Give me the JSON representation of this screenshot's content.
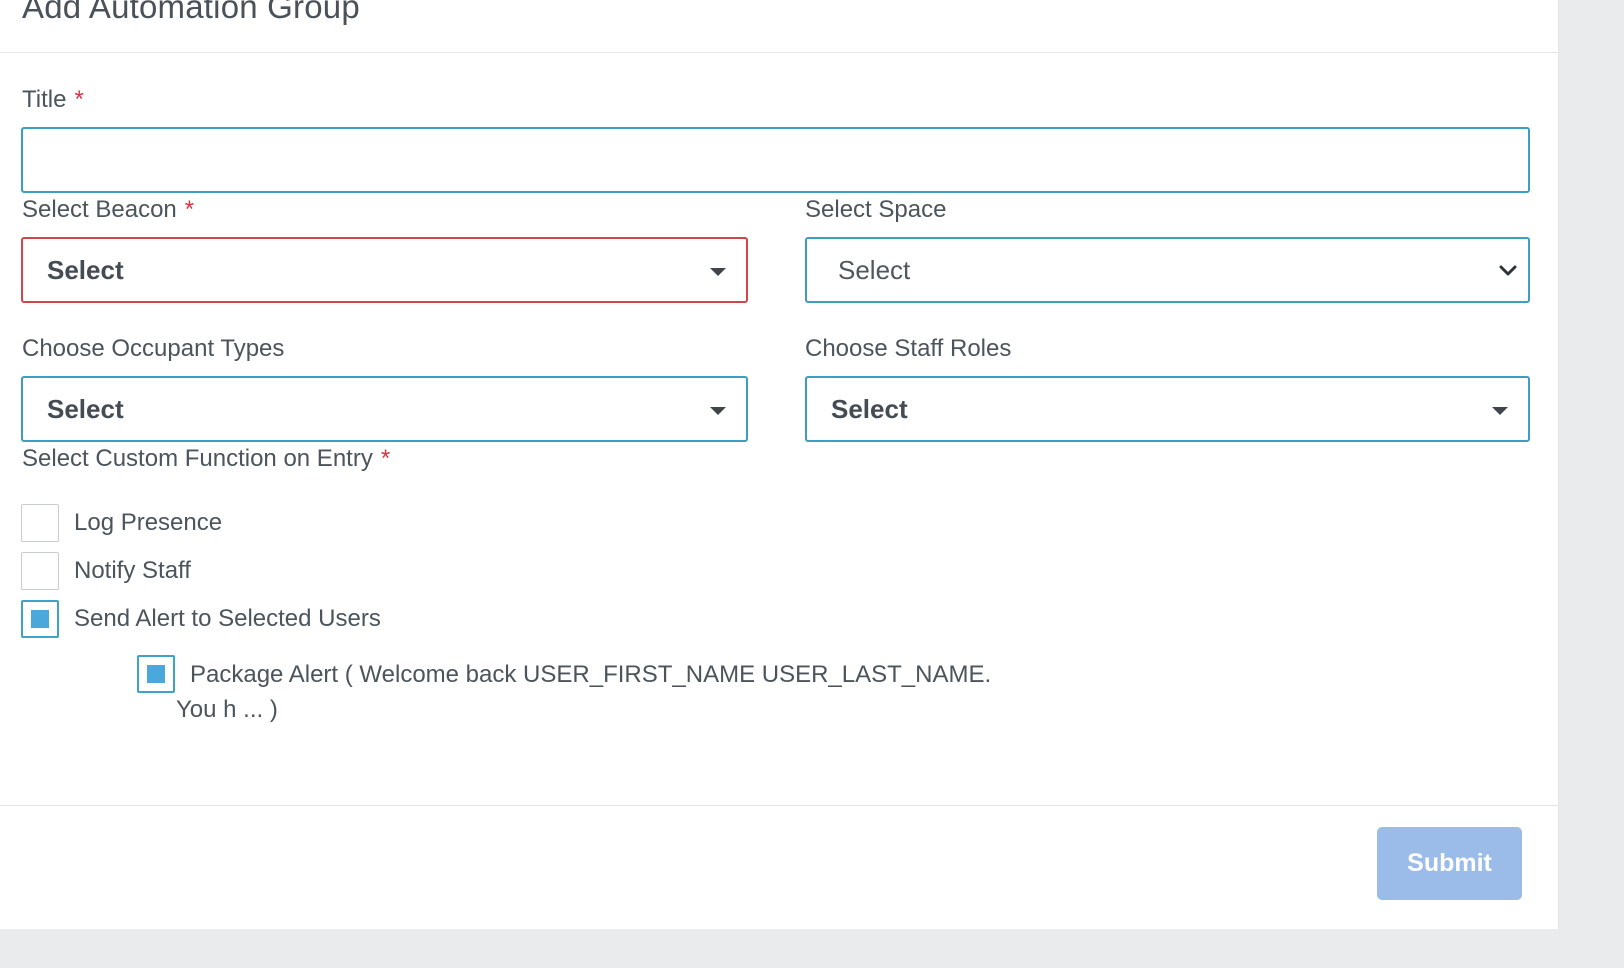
{
  "modal": {
    "title": "Add Automation Group"
  },
  "form": {
    "title": {
      "label": "Title",
      "required_mark": "*",
      "value": "",
      "placeholder": ""
    },
    "beacon": {
      "label": "Select Beacon",
      "required_mark": "*",
      "value": "Select"
    },
    "space": {
      "label": "Select Space",
      "value": "Select"
    },
    "occupant_types": {
      "label": "Choose Occupant Types",
      "value": "Select"
    },
    "staff_roles": {
      "label": "Choose Staff Roles",
      "value": "Select"
    },
    "custom_function": {
      "label": "Select Custom Function on Entry",
      "required_mark": "*",
      "options": [
        {
          "label": "Log Presence",
          "checked": false
        },
        {
          "label": "Notify Staff",
          "checked": false
        },
        {
          "label": "Send Alert to Selected Users",
          "checked": true
        }
      ],
      "alert": {
        "label_line1": "Package Alert ( Welcome back USER_FIRST_NAME USER_LAST_NAME.",
        "label_line2": "You h ... )",
        "checked": true
      }
    }
  },
  "footer": {
    "submit_label": "Submit"
  },
  "colors": {
    "accent_border": "#3a9fc0",
    "error_border": "#d2454d",
    "required": "#d9343f",
    "checkbox_fill": "#4aa8da",
    "submit_bg": "#9bbce8"
  }
}
